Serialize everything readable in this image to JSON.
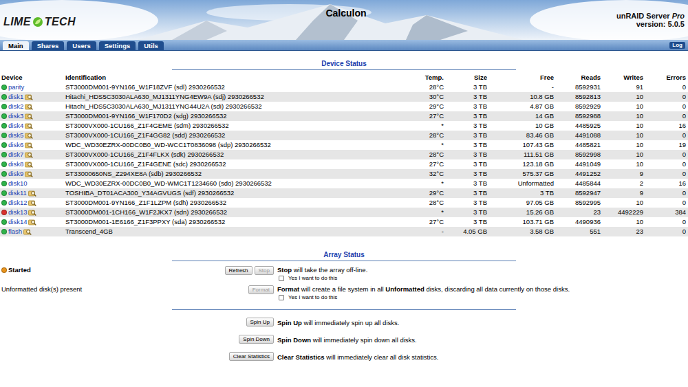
{
  "window": {
    "title": "Calculon"
  },
  "header": {
    "logo": {
      "left": "LIME",
      "right": "TECH"
    },
    "title": "Calculon",
    "product": "unRAID Server ",
    "edition": "Pro",
    "version": "version: 5.0.5"
  },
  "tabs": [
    {
      "label": "Main",
      "selected": true
    },
    {
      "label": "Shares",
      "selected": false
    },
    {
      "label": "Users",
      "selected": false
    },
    {
      "label": "Settings",
      "selected": false
    },
    {
      "label": "Utils",
      "selected": false
    }
  ],
  "log_button": "Log",
  "device_status": {
    "title": "Device Status",
    "columns": [
      "Device",
      "Identification",
      "Temp.",
      "Size",
      "Free",
      "Reads",
      "Writes",
      "Errors"
    ],
    "rows": [
      {
        "device": "parity",
        "color": "#2fb34a",
        "browsable": false,
        "identification": "ST3000DM001-9YN166_W1F18ZVF (sdl) 2930266532",
        "temp": "28°C",
        "size": "3 TB",
        "free": "-",
        "reads": "8592931",
        "writes": "91",
        "errors": "0"
      },
      {
        "device": "disk1",
        "color": "#2fb34a",
        "browsable": true,
        "identification": "Hitachi_HDS5C3030ALA630_MJ1311YNG4EW9A (sdj) 2930266532",
        "temp": "30°C",
        "size": "3 TB",
        "free": "10.8 GB",
        "reads": "8592813",
        "writes": "10",
        "errors": "0"
      },
      {
        "device": "disk2",
        "color": "#2fb34a",
        "browsable": true,
        "identification": "Hitachi_HDS5C3030ALA630_MJ1311YNG44U2A (sdi) 2930266532",
        "temp": "29°C",
        "size": "3 TB",
        "free": "4.87 GB",
        "reads": "8592929",
        "writes": "10",
        "errors": "0"
      },
      {
        "device": "disk3",
        "color": "#2fb34a",
        "browsable": true,
        "identification": "ST3000DM001-9YN166_W1F170D2 (sdg) 2930266532",
        "temp": "27°C",
        "size": "3 TB",
        "free": "14 GB",
        "reads": "8592988",
        "writes": "10",
        "errors": "0"
      },
      {
        "device": "disk4",
        "color": "#2fb34a",
        "browsable": true,
        "identification": "ST3000VX000-1CU166_Z1F4GEME (sdm) 2930266532",
        "temp": "*",
        "size": "3 TB",
        "free": "10 GB",
        "reads": "4485925",
        "writes": "10",
        "errors": "16"
      },
      {
        "device": "disk5",
        "color": "#2fb34a",
        "browsable": true,
        "identification": "ST3000VX000-1CU166_Z1F4GG82 (sdd) 2930266532",
        "temp": "28°C",
        "size": "3 TB",
        "free": "83.46 GB",
        "reads": "4491088",
        "writes": "10",
        "errors": "0"
      },
      {
        "device": "disk6",
        "color": "#2fb34a",
        "browsable": true,
        "identification": "WDC_WD30EZRX-00DC0B0_WD-WCC1T0836098 (sdp) 2930266532",
        "temp": "*",
        "size": "3 TB",
        "free": "107.43 GB",
        "reads": "4485821",
        "writes": "10",
        "errors": "19"
      },
      {
        "device": "disk7",
        "color": "#2fb34a",
        "browsable": true,
        "identification": "ST3000VX000-1CU166_Z1F4FLKX (sdk) 2930266532",
        "temp": "28°C",
        "size": "3 TB",
        "free": "111.51 GB",
        "reads": "8592998",
        "writes": "10",
        "errors": "0"
      },
      {
        "device": "disk8",
        "color": "#2fb34a",
        "browsable": true,
        "identification": "ST3000VX000-1CU166_Z1F4GENE (sdc) 2930266532",
        "temp": "27°C",
        "size": "3 TB",
        "free": "123.18 GB",
        "reads": "4491049",
        "writes": "10",
        "errors": "0"
      },
      {
        "device": "disk9",
        "color": "#2fb34a",
        "browsable": true,
        "identification": "ST33000650NS_Z294XE8A (sdb) 2930266532",
        "temp": "32°C",
        "size": "3 TB",
        "free": "575.37 GB",
        "reads": "4491252",
        "writes": "9",
        "errors": "0"
      },
      {
        "device": "disk10",
        "color": "#2fb34a",
        "browsable": false,
        "identification": "WDC_WD30EZRX-00DC0B0_WD-WMC1T1234660 (sdo) 2930266532",
        "temp": "*",
        "size": "3 TB",
        "free": "Unformatted",
        "reads": "4485844",
        "writes": "2",
        "errors": "16"
      },
      {
        "device": "disk11",
        "color": "#2fb34a",
        "browsable": true,
        "identification": "TOSHIBA_DT01ACA300_Y34AGVUGS (sdf) 2930266532",
        "temp": "29°C",
        "size": "3 TB",
        "free": "3 TB",
        "reads": "8592947",
        "writes": "9",
        "errors": "0"
      },
      {
        "device": "disk12",
        "color": "#2fb34a",
        "browsable": true,
        "identification": "ST3000DM001-9YN166_Z1F1LZPM (sdh) 2930266532",
        "temp": "28°C",
        "size": "3 TB",
        "free": "97.05 GB",
        "reads": "8592995",
        "writes": "10",
        "errors": "0"
      },
      {
        "device": "disk13",
        "color": "#d9302c",
        "browsable": true,
        "identification": "ST3000DM001-1CH166_W1F2JKX7 (sdn) 2930266532",
        "temp": "*",
        "size": "3 TB",
        "free": "15.26 GB",
        "reads": "23",
        "writes": "4492229",
        "errors": "384"
      },
      {
        "device": "disk14",
        "color": "#2fb34a",
        "browsable": true,
        "identification": "ST3000DM001-1E6166_Z1F3PPXY (sda) 2930266532",
        "temp": "27°C",
        "size": "3 TB",
        "free": "103.71 GB",
        "reads": "4490936",
        "writes": "10",
        "errors": "0"
      },
      {
        "device": "flash",
        "color": "#2fb34a",
        "browsable": true,
        "identification": "Transcend_4GB",
        "temp": "-",
        "size": "4.05 GB",
        "free": "3.58 GB",
        "reads": "551",
        "writes": "23",
        "errors": "0"
      }
    ]
  },
  "array_status": {
    "title": "Array Status",
    "rows": [
      {
        "status": "Started",
        "dot_color": "#e8931c",
        "buttons": [
          {
            "label": "Refresh",
            "disabled": false
          },
          {
            "label": "Stop",
            "disabled": true
          }
        ],
        "description": [
          {
            "text": "Stop",
            "bold": true
          },
          {
            "text": " will take the array off-line.",
            "bold": false
          }
        ],
        "confirm": {
          "label": "Yes I want to do this",
          "checked": false
        }
      },
      {
        "status": "Unformatted disk(s) present",
        "dot_color": null,
        "buttons": [
          {
            "label": "Format",
            "disabled": true
          }
        ],
        "description": [
          {
            "text": "Format",
            "bold": true
          },
          {
            "text": " will create a file system in all ",
            "bold": false
          },
          {
            "text": "Unformatted",
            "bold": true
          },
          {
            "text": " disks, discarding all data currently on those disks.",
            "bold": false
          }
        ],
        "confirm": {
          "label": "Yes I want to do this",
          "checked": false
        }
      }
    ],
    "actions": [
      {
        "button": "Spin Up",
        "description": [
          {
            "text": "Spin Up",
            "bold": true
          },
          {
            "text": " will immediately spin up all disks.",
            "bold": false
          }
        ]
      },
      {
        "button": "Spin Down",
        "description": [
          {
            "text": "Spin Down",
            "bold": true
          },
          {
            "text": " will immediately spin down all disks.",
            "bold": false
          }
        ]
      },
      {
        "button": "Clear Statistics",
        "description": [
          {
            "text": "Clear Statistics",
            "bold": true
          },
          {
            "text": " will immediately clear all disk statistics.",
            "bold": false
          }
        ]
      }
    ]
  }
}
